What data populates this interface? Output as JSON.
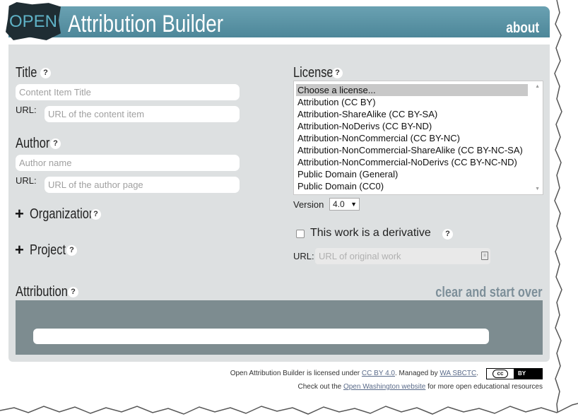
{
  "header": {
    "logo_text": "OPEN",
    "app_title": "Attribution Builder",
    "about_label": "about"
  },
  "title_section": {
    "label": "Title",
    "help": "?",
    "title_placeholder": "Content Item Title",
    "url_label": "URL:",
    "url_placeholder": "URL of the content item"
  },
  "author_section": {
    "label": "Author",
    "help": "?",
    "name_placeholder": "Author name",
    "url_label": "URL:",
    "url_placeholder": "URL of the author page"
  },
  "organization": {
    "plus": "+",
    "label": "Organization",
    "help": "?"
  },
  "project": {
    "plus": "+",
    "label": "Project",
    "help": "?"
  },
  "license_section": {
    "label": "License",
    "help": "?",
    "options": [
      "Choose a license...",
      "Attribution (CC BY)",
      "Attribution-ShareAlike (CC BY-SA)",
      "Attribution-NoDerivs (CC BY-ND)",
      "Attribution-NonCommercial (CC BY-NC)",
      "Attribution-NonCommercial-ShareAlike (CC BY-NC-SA)",
      "Attribution-NonCommercial-NoDerivs (CC BY-NC-ND)",
      "Public Domain (General)",
      "Public Domain (CC0)"
    ],
    "selected_index": 0,
    "version_label": "Version",
    "version_value": "4.0"
  },
  "derivative": {
    "checkbox_label": "This work is a derivative",
    "help": "?",
    "checked": false,
    "url_label": "URL:",
    "url_placeholder": "URL of original work"
  },
  "attribution": {
    "label": "Attribution",
    "help": "?",
    "clear_label": "clear and start over"
  },
  "footer": {
    "line1_prefix": "Open Attribution Builder is licensed under ",
    "line1_link1": "CC BY 4.0",
    "line1_mid": ". Managed by ",
    "line1_link2": "WA SBCTC",
    "line1_suffix": ".",
    "badge_left": "cc",
    "badge_right": "BY",
    "line2_prefix": "Check out the ",
    "line2_link": "Open Washington website",
    "line2_suffix": " for more open educational resources"
  },
  "colors": {
    "header_bg": "#5a93a5",
    "panel_bg": "#dde0e1",
    "attribution_box_bg": "#7d8c90",
    "logo_text": "#5fb2c6",
    "link": "#5a6b8a"
  }
}
